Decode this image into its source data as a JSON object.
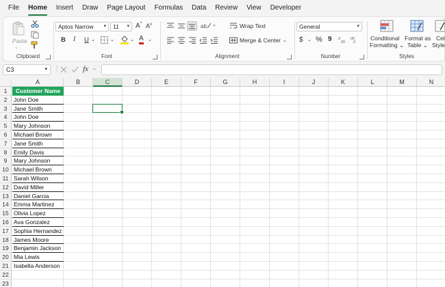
{
  "tabs": [
    "File",
    "Home",
    "Insert",
    "Draw",
    "Page Layout",
    "Formulas",
    "Data",
    "Review",
    "View",
    "Developer"
  ],
  "active_tab": "Home",
  "ribbon": {
    "clipboard": {
      "paste": "Paste",
      "label": "Clipboard"
    },
    "font": {
      "font_name": "Aptos Narrow",
      "font_size": "11",
      "grow": "A",
      "shrink": "A",
      "bold": "B",
      "italic": "I",
      "underline": "U",
      "font_color_letter": "A",
      "label": "Font"
    },
    "alignment": {
      "wrap_text": "Wrap Text",
      "merge_center": "Merge & Center",
      "label": "Alignment"
    },
    "number": {
      "format": "General",
      "currency": "$",
      "percent": "%",
      "comma": "9",
      "label": "Number"
    },
    "styles": {
      "conditional_line1": "Conditional",
      "conditional_line2": "Formatting",
      "format_table_line1": "Format as",
      "format_table_line2": "Table",
      "cell_styles_line1": "Cell",
      "cell_styles_line2": "Styles",
      "label": "Styles"
    }
  },
  "formula_bar": {
    "name_box": "C3",
    "fx": "fx",
    "value": ""
  },
  "columns": [
    "A",
    "B",
    "C",
    "D",
    "E",
    "F",
    "G",
    "H",
    "I",
    "J",
    "K",
    "L",
    "M",
    "N"
  ],
  "selected_column": "C",
  "selected_cell": "C3",
  "rows": [
    "1",
    "2",
    "3",
    "4",
    "5",
    "6",
    "7",
    "8",
    "9",
    "10",
    "11",
    "12",
    "13",
    "14",
    "15",
    "16",
    "17",
    "18",
    "19",
    "20",
    "21",
    "22",
    "23"
  ],
  "column_a": {
    "header": "Customer Name",
    "values": [
      "John Doe",
      "Jane Smith",
      "John Doe",
      "Mary Johnson",
      "Michael Brown",
      "Jane Smith",
      "Emily Davis",
      "Mary Johnson",
      "Michael Brown",
      "Sarah Wilson",
      "David Miller",
      "Daniel Garcia",
      "Emma Martinez",
      "Olivia Lopez",
      "Ava Gonzalez",
      "Sophia Hernandez",
      "James Moore",
      "Benjamin Jackson",
      "Mia Lewis",
      "Isabella Anderson"
    ]
  },
  "colors": {
    "accent": "#1f7a3f",
    "header_fill": "#21a35a"
  }
}
